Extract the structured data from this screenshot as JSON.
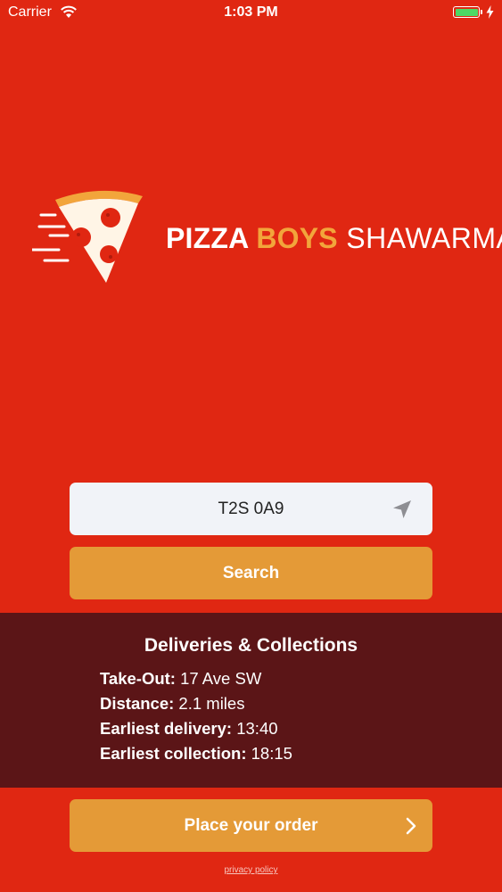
{
  "status_bar": {
    "carrier": "Carrier",
    "time": "1:03 PM",
    "battery_level": 1.0,
    "icons": [
      "wifi-icon",
      "battery-icon",
      "charging-bolt-icon"
    ]
  },
  "logo": {
    "word1": "PIZZA ",
    "word2": "BOYS",
    "word3": " SHAWARMA",
    "icon": "pizza-slice-icon"
  },
  "search": {
    "value": "T2S 0A9",
    "location_icon": "location-arrow-icon",
    "button_label": "Search"
  },
  "info": {
    "title": "Deliveries & Collections",
    "rows": [
      {
        "label": "Take-Out:",
        "value": " 17 Ave SW"
      },
      {
        "label": "Distance:",
        "value": " 2.1 miles"
      },
      {
        "label": "Earliest delivery:",
        "value": " 13:40"
      },
      {
        "label": "Earliest collection:",
        "value": " 18:15"
      }
    ]
  },
  "order": {
    "button_label": "Place your order",
    "chevron_icon": "chevron-right-icon"
  },
  "footer": {
    "privacy_label": "privacy policy"
  },
  "colors": {
    "background": "#e02712",
    "accent": "#e49a37",
    "panel": "#5b1517",
    "field": "#f1f3f8",
    "brand_orange": "#f2a53b"
  }
}
